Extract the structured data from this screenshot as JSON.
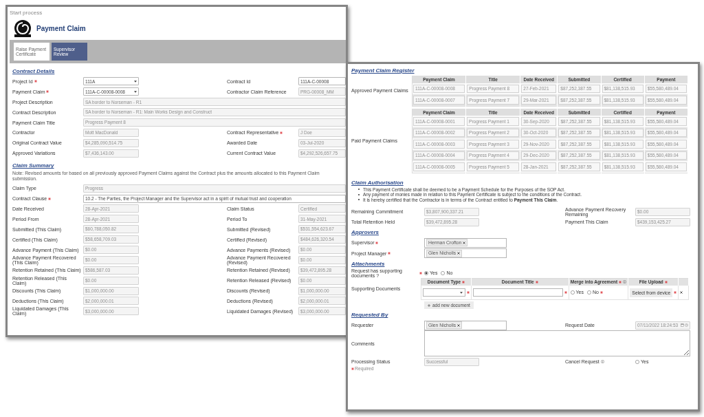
{
  "process_window": {
    "title": "Start process",
    "heading": "Payment Claim",
    "stages": [
      {
        "label": "Raise Payment Certificate",
        "selected": true
      },
      {
        "label": "Supervisor Review",
        "selected": false
      }
    ],
    "sections": [
      {
        "title": "Contract Details",
        "rows": [
          {
            "left": {
              "label": "Project Id",
              "required": true,
              "kind": "select",
              "value": "111A"
            },
            "right": {
              "label": "Contract Id",
              "kind": "input",
              "value": "111A-C-00008"
            }
          },
          {
            "left": {
              "label": "Payment Claim",
              "required": true,
              "kind": "select",
              "value": "111A-C-00008-0008"
            },
            "right": {
              "label": "Contractor Claim Reference",
              "kind": "readonly",
              "value": "PRG-00008_MM"
            }
          },
          {
            "full": {
              "label": "Project Description",
              "kind": "readonly",
              "value": "SA border to Norseman - R1"
            }
          },
          {
            "full": {
              "label": "Contract Description",
              "kind": "readonly",
              "value": "SA border to Norseman - R1: Main Works Design and Construct"
            }
          },
          {
            "full": {
              "label": "Payment Claim Title",
              "kind": "readonly",
              "value": "Progress Payment 8"
            }
          },
          {
            "left": {
              "label": "Contractor",
              "kind": "readonly",
              "value": "Mott MacDonald"
            },
            "right": {
              "label": "Contract Representative",
              "required": true,
              "kind": "readonly",
              "value": "J Doe"
            }
          },
          {
            "left": {
              "label": "Original Contract Value",
              "kind": "readonly",
              "value": "$4,285,090,514.75"
            },
            "right": {
              "label": "Awarded Date",
              "kind": "readonly",
              "value": "03-Jul-2020"
            }
          },
          {
            "left": {
              "label": "Approved Variations",
              "kind": "readonly",
              "value": "$7,436,143.00"
            },
            "right": {
              "label": "Current Contract Value",
              "kind": "readonly",
              "value": "$4,292,526,657.75"
            }
          }
        ]
      },
      {
        "title": "Claim Summary",
        "note": "Note: Revised amounts for based on all previously approved Payment Claims against the Contract plus the amounts allocated to this Payment Claim submission.",
        "rows": [
          {
            "full": {
              "label": "Claim Type",
              "kind": "readonly",
              "value": "Progress"
            }
          },
          {
            "full": {
              "label": "Contract Clause",
              "required": true,
              "kind": "input",
              "value": "10.2 - The Parties, the Project Manager and the Supervisor act in a spirit of mutual trust and cooperation"
            }
          },
          {
            "left": {
              "label": "Date Received",
              "kind": "readonly",
              "value": "28-Apr-2021"
            },
            "right": {
              "label": "Claim Status",
              "kind": "readonly",
              "value": "Certified"
            }
          },
          {
            "left": {
              "label": "Period From",
              "kind": "readonly",
              "value": "28-Apr-2021"
            },
            "right": {
              "label": "Period To",
              "kind": "readonly",
              "value": "31-May-2021"
            }
          },
          {
            "left": {
              "label": "Submitted (This Claim)",
              "kind": "readonly",
              "value": "$60,788,050.82"
            },
            "right": {
              "label": "Submitted (Revised)",
              "kind": "readonly",
              "value": "$531,554,623.67"
            }
          },
          {
            "left": {
              "label": "Certified (This Claim)",
              "kind": "readonly",
              "value": "$58,658,709.03"
            },
            "right": {
              "label": "Certified (Revised)",
              "kind": "readonly",
              "value": "$484,626,320.54"
            }
          },
          {
            "left": {
              "label": "Advance Payment (This Claim)",
              "kind": "readonly",
              "value": "$0.00"
            },
            "right": {
              "label": "Advance Payments (Revised)",
              "kind": "readonly",
              "value": "$0.00"
            }
          },
          {
            "left": {
              "label": "Advance Payment Recovered (This Claim)",
              "kind": "readonly",
              "value": "$0.00"
            },
            "right": {
              "label": "Advance Payment Recovered (Revised)",
              "kind": "readonly",
              "value": "$0.00"
            }
          },
          {
            "left": {
              "label": "Retention Retained (This Claim)",
              "kind": "readonly",
              "value": "$586,587.03"
            },
            "right": {
              "label": "Retention Retained (Revised)",
              "kind": "readonly",
              "value": "$39,472,895.28"
            }
          },
          {
            "left": {
              "label": "Retention Released (This Claim)",
              "kind": "readonly",
              "value": "$0.00"
            },
            "right": {
              "label": "Retention Released (Revised)",
              "kind": "readonly",
              "value": "$0.00"
            }
          },
          {
            "left": {
              "label": "Discounts (This Claim)",
              "kind": "readonly",
              "value": "$1,000,000.00"
            },
            "right": {
              "label": "Discounts (Revised)",
              "kind": "readonly",
              "value": "$1,000,000.00"
            }
          },
          {
            "left": {
              "label": "Deductions (This Claim)",
              "kind": "readonly",
              "value": "$2,000,000.01"
            },
            "right": {
              "label": "Deductions (Revised)",
              "kind": "readonly",
              "value": "$2,000,000.01"
            }
          },
          {
            "left": {
              "label": "Liquidated Damages (This Claim)",
              "kind": "readonly",
              "value": "$3,000,000.00"
            },
            "right": {
              "label": "Liquidated Damages (Revised)",
              "kind": "readonly",
              "value": "$3,000,000.00"
            }
          }
        ]
      }
    ]
  },
  "register_window": {
    "register": {
      "title": "Payment Claim Register",
      "groups": [
        {
          "label": "Approved Payment Claims",
          "columns": [
            "Payment Claim",
            "Title",
            "Date Received",
            "Submitted",
            "Certified",
            "Payment"
          ],
          "rows": [
            [
              "111A-C-00008-0008",
              "Progress Payment 8",
              "27-Feb-2021",
              "$87,252,387.55",
              "$81,138,515.93",
              "$55,580,489.04"
            ],
            [
              "111A-C-00008-0007",
              "Progress Payment 7",
              "29-Mar-2021",
              "$87,252,387.55",
              "$81,138,515.93",
              "$55,580,489.04"
            ]
          ]
        },
        {
          "label": "Paid Payment Claims",
          "columns": [
            "Payment Claim",
            "Title",
            "Date Received",
            "Submitted",
            "Certified",
            "Payment"
          ],
          "rows": [
            [
              "111A-C-00008-0001",
              "Progress Payment 1",
              "30-Sep-2020",
              "$87,252,387.55",
              "$81,138,515.93",
              "$55,580,489.04"
            ],
            [
              "111A-C-00008-0002",
              "Progress Payment 2",
              "30-Oct-2020",
              "$87,252,387.55",
              "$81,138,515.93",
              "$55,580,489.04"
            ],
            [
              "111A-C-00008-0003",
              "Progress Payment 3",
              "29-Nov-2020",
              "$87,252,387.55",
              "$81,138,515.93",
              "$55,580,489.04"
            ],
            [
              "111A-C-00008-0004",
              "Progress Payment 4",
              "29-Dec-2020",
              "$87,252,387.55",
              "$81,138,515.93",
              "$55,580,489.04"
            ],
            [
              "111A-C-00008-0005",
              "Progress Payment 5",
              "28-Jan-2021",
              "$87,252,387.55",
              "$81,138,515.93",
              "$55,580,489.04"
            ]
          ]
        }
      ]
    },
    "authorisation": {
      "title": "Claim Authorisation",
      "bullets": [
        "This Payment Certificate shall be deemed to be a Payment Schedule for the Purposes of the SOP Act.",
        "Any payment of monies made in relation to this Payment Certificate is subject to the conditions of the Contract.",
        "It is hereby certified that the Contractor is in terms of the Contract entitled to **Payment This Claim**."
      ],
      "rows": [
        {
          "left": {
            "label": "Remaining Commitment",
            "kind": "readonly",
            "value": "$3,807,900,337.21"
          },
          "right": {
            "label": "Advance Payment Recovery Remaining",
            "kind": "readonly",
            "value": "$0.00"
          }
        },
        {
          "left": {
            "label": "Total Retention Held",
            "kind": "readonly",
            "value": "$39,472,895.28"
          },
          "right": {
            "label": "Payment This Claim",
            "kind": "readonly",
            "value": "$439,153,425.27"
          }
        }
      ]
    },
    "approvers": {
      "title": "Approvers",
      "rows": [
        {
          "left": {
            "label": "Supervisor",
            "required": true,
            "kind": "people",
            "people": [
              "Herman Crofton"
            ]
          }
        },
        {
          "left": {
            "label": "Project Manager",
            "required": true,
            "kind": "people",
            "people": [
              "Glen Nicholls"
            ]
          }
        }
      ]
    },
    "attachments": {
      "title": "Attachments",
      "rows": [
        {
          "left": {
            "label": "Request has supporting documents ?",
            "required": true,
            "kind": "radio",
            "options": [
              {
                "label": "Yes",
                "selected": true
              },
              {
                "label": "No",
                "selected": false
              }
            ]
          }
        }
      ],
      "documents": {
        "label": "Supporting Documents",
        "columns": [
          {
            "label": "Document Type",
            "required": true
          },
          {
            "label": "Document Title",
            "required": true
          },
          {
            "label": "Merge into Agreement",
            "required": true,
            "info": true
          },
          {
            "label": "File Upload",
            "required": true
          }
        ],
        "merge_options": [
          {
            "label": "Yes",
            "selected": false
          },
          {
            "label": "No",
            "selected": false
          }
        ],
        "upload_button": "Select from device"
      },
      "add_button": "add new document"
    },
    "requested_by": {
      "title": "Requested By",
      "rows": [
        {
          "left": {
            "label": "Requester",
            "kind": "people",
            "people": [
              "Glen Nicholls"
            ]
          },
          "right": {
            "label": "Request Date",
            "kind": "date",
            "value": "07/11/2022 18:24:53"
          }
        },
        {
          "full": {
            "label": "Comments",
            "kind": "textarea"
          }
        },
        {
          "left": {
            "label": "Processing Status",
            "kind": "readonly",
            "value": "Successful"
          },
          "right": {
            "label": "Cancel Request",
            "info": true,
            "kind": "radio",
            "options": [
              {
                "label": "Yes",
                "selected": false
              }
            ]
          }
        }
      ],
      "required_note": "Required"
    }
  }
}
